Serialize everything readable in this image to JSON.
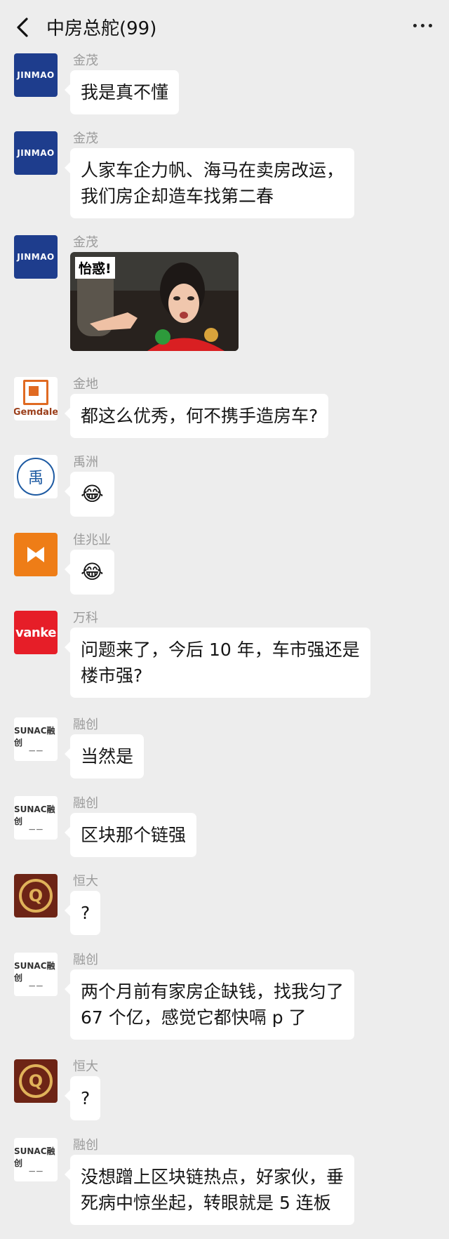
{
  "header": {
    "title": "中房总舵(99)"
  },
  "messages": [
    {
      "sender": "金茂",
      "avatar": "JINMAO",
      "text": "我是真不懂"
    },
    {
      "sender": "金茂",
      "avatar": "JINMAO",
      "text": "人家车企力帆、海马在卖房改运，\n我们房企却造车找第二春"
    },
    {
      "sender": "金茂",
      "avatar": "JINMAO",
      "image_caption": "怡惑!"
    },
    {
      "sender": "金地",
      "avatar": "Gemdale",
      "text": "都这么优秀，何不携手造房车?"
    },
    {
      "sender": "禹洲",
      "avatar": "禹",
      "emoji": "😂"
    },
    {
      "sender": "佳兆业",
      "avatar": "kaisa",
      "emoji": "😂"
    },
    {
      "sender": "万科",
      "avatar": "vanke",
      "text": "问题来了，今后 10 年，车市强还是\n楼市强?"
    },
    {
      "sender": "融创",
      "avatar": "SUNAC融创",
      "text": "当然是"
    },
    {
      "sender": "融创",
      "avatar": "SUNAC融创",
      "text": "区块那个链强"
    },
    {
      "sender": "恒大",
      "avatar": "evergrande",
      "text": "?"
    },
    {
      "sender": "融创",
      "avatar": "SUNAC融创",
      "text": "两个月前有家房企缺钱，找我匀了\n67 个亿，感觉它都快嗝 p 了"
    },
    {
      "sender": "恒大",
      "avatar": "evergrande",
      "text": "?"
    },
    {
      "sender": "融创",
      "avatar": "SUNAC融创",
      "text": "没想蹭上区块链热点，好家伙，垂\n死病中惊坐起，转眼就是 5 连板"
    }
  ]
}
